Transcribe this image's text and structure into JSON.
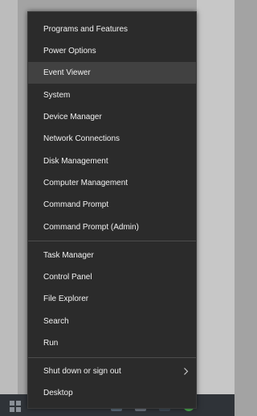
{
  "menu": {
    "group1": [
      {
        "label": "Programs and Features"
      },
      {
        "label": "Power Options"
      },
      {
        "label": "Event Viewer",
        "highlighted": true
      },
      {
        "label": "System"
      },
      {
        "label": "Device Manager"
      },
      {
        "label": "Network Connections"
      },
      {
        "label": "Disk Management"
      },
      {
        "label": "Computer Management"
      },
      {
        "label": "Command Prompt"
      },
      {
        "label": "Command Prompt (Admin)"
      }
    ],
    "group2": [
      {
        "label": "Task Manager"
      },
      {
        "label": "Control Panel"
      },
      {
        "label": "File Explorer"
      },
      {
        "label": "Search"
      },
      {
        "label": "Run"
      }
    ],
    "group3": [
      {
        "label": "Shut down or sign out",
        "submenu": true
      },
      {
        "label": "Desktop"
      }
    ]
  },
  "colors": {
    "menu_background": "#2b2b2b",
    "highlight": "#414141",
    "text": "#f2f2f2",
    "separator": "#4d4d4d",
    "taskbar": "#2f3338"
  }
}
